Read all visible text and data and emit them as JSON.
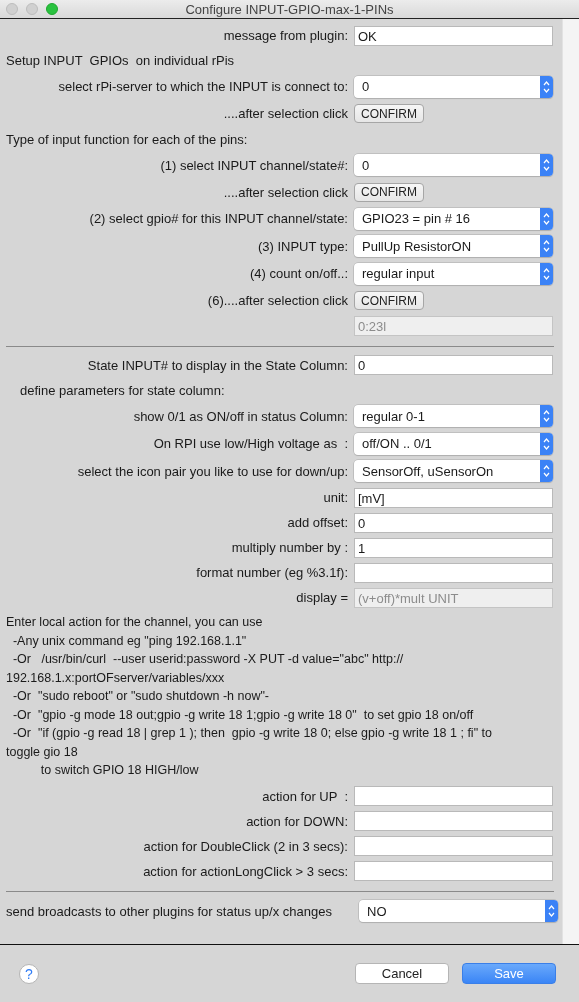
{
  "window": {
    "title": "Configure INPUT-GPIO-max-1-PINs"
  },
  "form": {
    "rows": [
      {
        "kind": "field",
        "label": "message from plugin:",
        "value": "OK"
      },
      {
        "kind": "heading",
        "text": "Setup INPUT  GPIOs  on individual rPis"
      },
      {
        "kind": "popup",
        "label": "select rPi-server to which the INPUT is connect to:",
        "value": "0"
      },
      {
        "kind": "button",
        "label": "....after selection click",
        "button": "CONFIRM"
      },
      {
        "kind": "heading",
        "text": "Type of input function for each of the pins:"
      },
      {
        "kind": "popup",
        "label": "(1) select INPUT channel/state#:",
        "value": "0"
      },
      {
        "kind": "button",
        "label": "....after selection click",
        "button": "CONFIRM"
      },
      {
        "kind": "popup",
        "label": "(2) select gpio# for this INPUT channel/state:",
        "value": "GPIO23 = pin # 16"
      },
      {
        "kind": "popup",
        "label": "(3) INPUT type:",
        "value": "PullUp ResistorON"
      },
      {
        "kind": "popup",
        "label": "(4) count on/off..:",
        "value": "regular input"
      },
      {
        "kind": "button",
        "label": "(6)....after selection click",
        "button": "CONFIRM"
      },
      {
        "kind": "readonly",
        "value": "0:23l"
      },
      {
        "kind": "separator"
      },
      {
        "kind": "field",
        "label": "State INPUT# to display in the State Column:",
        "value": "0"
      },
      {
        "kind": "subheading",
        "text": "define parameters for state column:"
      },
      {
        "kind": "popup",
        "label": "show 0/1 as ON/off in status Column:",
        "value": "regular 0-1"
      },
      {
        "kind": "popup",
        "label": "On RPI use low/High voltage as  :",
        "value": "off/ON .. 0/1"
      },
      {
        "kind": "popup",
        "label": "select the icon pair you like to use for down/up:",
        "value": "SensorOff, uSensorOn"
      },
      {
        "kind": "field",
        "label": "unit:",
        "value": "[mV]"
      },
      {
        "kind": "field",
        "label": "add offset:",
        "value": "0"
      },
      {
        "kind": "field",
        "label": "multiply number by :",
        "value": "1"
      },
      {
        "kind": "field",
        "label": "format number (eg %3.1f):"
      },
      {
        "kind": "readonly",
        "label": "display =",
        "value": "(v+off)*mult UNIT"
      },
      {
        "kind": "text",
        "lines": [
          "Enter local action for the channel, you can use",
          "  -Any unix command eg \"ping 192.168.1.1\"",
          "  -Or   /usr/bin/curl  --user userid:password -X PUT -d value=\"abc\" http://",
          "192.168.1.x:portOFserver/variables/xxx",
          "  -Or  \"sudo reboot\" or \"sudo shutdown -h now\"-",
          "  -Or  \"gpio -g mode 18 out;gpio -g write 18 1;gpio -g write 18 0\"  to set gpio 18 on/off",
          "  -Or  \"if (gpio -g read 18 | grep 1 ); then  gpio -g write 18 0; else gpio -g write 18 1 ; fi\" to",
          "toggle gio 18",
          "          to switch GPIO 18 HIGH/low"
        ]
      },
      {
        "kind": "field",
        "label": "action for UP  :"
      },
      {
        "kind": "field",
        "label": "action for DOWN:"
      },
      {
        "kind": "field",
        "label": "action for DoubleClick (2 in 3 secs):"
      },
      {
        "kind": "field",
        "label": "action for actionLongClick > 3 secs:"
      },
      {
        "kind": "separator"
      },
      {
        "kind": "popup",
        "label": "send broadcasts to other plugins for status up/x changes",
        "value": "NO"
      }
    ]
  },
  "footer": {
    "help": "?",
    "buttons": [
      {
        "label": "Cancel",
        "default": false
      },
      {
        "label": "Save",
        "default": true
      }
    ]
  }
}
